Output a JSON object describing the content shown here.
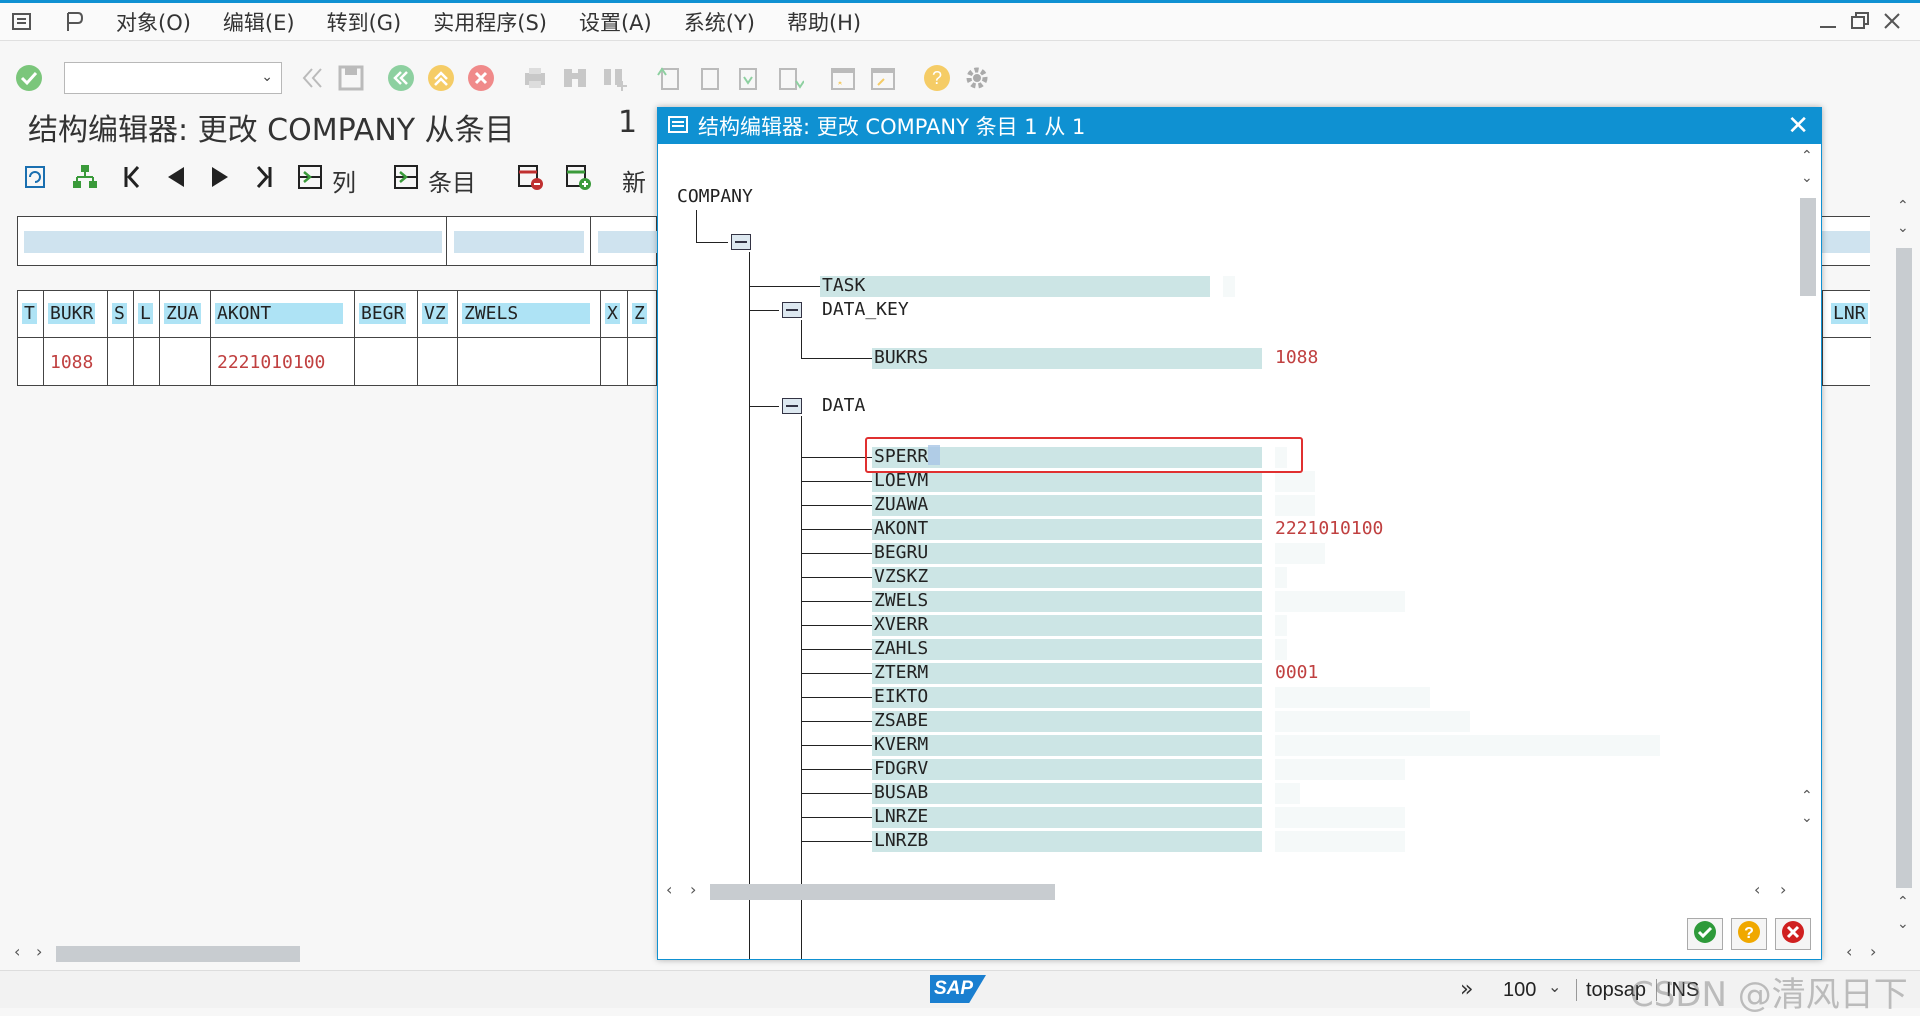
{
  "menubar": {
    "items": [
      {
        "label": "对象(O)",
        "hotkey": "O"
      },
      {
        "label": "编辑(E)",
        "hotkey": "E"
      },
      {
        "label": "转到(G)",
        "hotkey": "G"
      },
      {
        "label": "实用程序(S)",
        "hotkey": "S"
      },
      {
        "label": "设置(A)",
        "hotkey": "A"
      },
      {
        "label": "系统(Y)",
        "hotkey": "Y"
      },
      {
        "label": "帮助(H)",
        "hotkey": "H"
      }
    ]
  },
  "command_field": {
    "value": ""
  },
  "main": {
    "title": "结构编辑器: 更改 COMPANY 从条目",
    "title_number": "1",
    "app_toolbar": {
      "columns_label": "列",
      "entries_label": "条目",
      "new_label": "新"
    },
    "grid": {
      "headers": [
        "T",
        "BUKR",
        "S",
        "L",
        "ZUA",
        "AKONT",
        "BEGR",
        "VZ",
        "ZWELS",
        "X",
        "Z"
      ],
      "row": [
        "",
        "1088",
        "",
        "",
        "",
        "2221010100",
        "",
        "",
        "",
        "",
        ""
      ],
      "right_header": "LNR"
    }
  },
  "dialog": {
    "title": "结构编辑器: 更改 COMPANY 条目 1 从 1",
    "root": "COMPANY",
    "task_label": "TASK",
    "data_key_label": "DATA_KEY",
    "bukrs_label": "BUKRS",
    "bukrs_value": "1088",
    "data_label": "DATA",
    "fields": [
      {
        "name": "SPERR",
        "value": ""
      },
      {
        "name": "LOEVM",
        "value": ""
      },
      {
        "name": "ZUAWA",
        "value": ""
      },
      {
        "name": "AKONT",
        "value": "2221010100"
      },
      {
        "name": "BEGRU",
        "value": ""
      },
      {
        "name": "VZSKZ",
        "value": ""
      },
      {
        "name": "ZWELS",
        "value": ""
      },
      {
        "name": "XVERR",
        "value": ""
      },
      {
        "name": "ZAHLS",
        "value": ""
      },
      {
        "name": "ZTERM",
        "value": "0001"
      },
      {
        "name": "EIKTO",
        "value": ""
      },
      {
        "name": "ZSABE",
        "value": ""
      },
      {
        "name": "KVERM",
        "value": ""
      },
      {
        "name": "FDGRV",
        "value": ""
      },
      {
        "name": "BUSAB",
        "value": ""
      },
      {
        "name": "LNRZE",
        "value": ""
      },
      {
        "name": "LNRZB",
        "value": ""
      }
    ]
  },
  "statusbar": {
    "sap_logo": "SAP",
    "zoom": "100",
    "system": "topsap",
    "mode": "INS",
    "watermark": "CSDN @清风日下"
  },
  "colors": {
    "accent": "#0f91d2",
    "field_bg": "#cce5e5",
    "value_red": "#c04040",
    "header_highlight": "#aee3f5",
    "selection_border": "#e03030"
  }
}
